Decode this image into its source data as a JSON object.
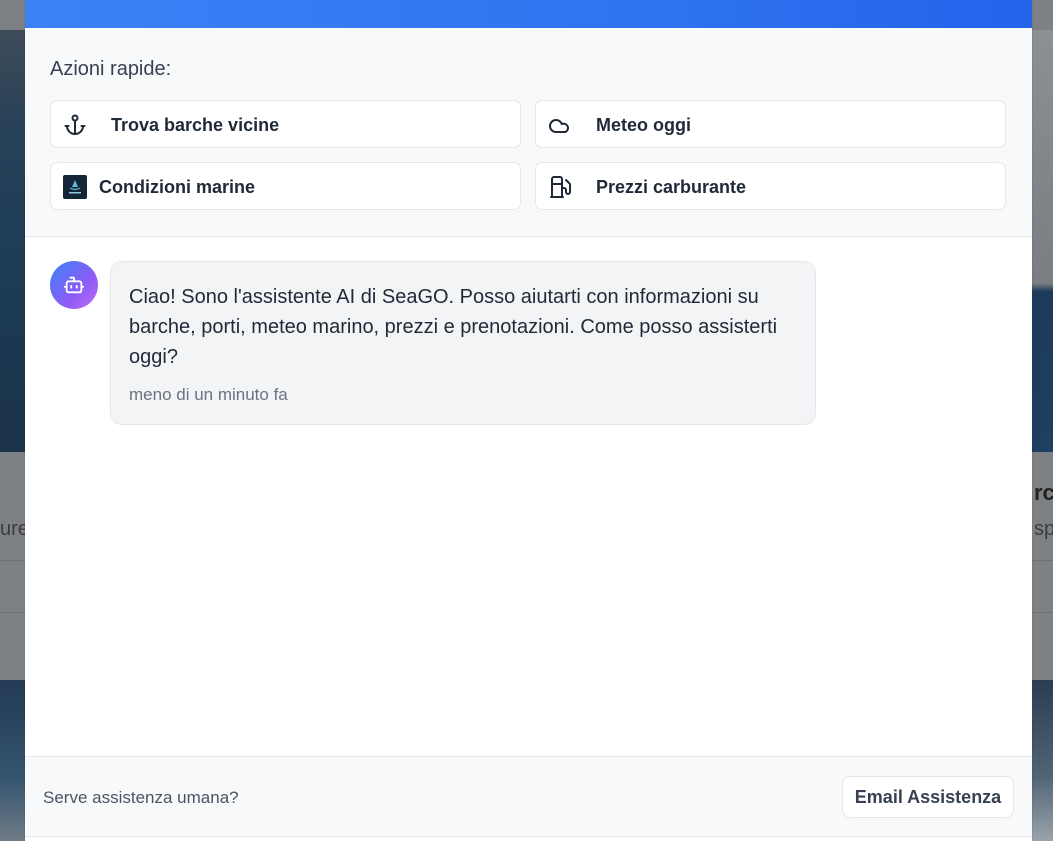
{
  "background": {
    "left_fragment": "ure",
    "right_bold_fragment": "rch",
    "right_fragment": "spe"
  },
  "quick_actions": {
    "title": "Azioni rapide:",
    "items": [
      {
        "label": "Trova barche vicine",
        "icon": "anchor-icon"
      },
      {
        "label": "Meteo oggi",
        "icon": "cloud-icon"
      },
      {
        "label": "Condizioni marine",
        "icon": "seago-logo"
      },
      {
        "label": "Prezzi carburante",
        "icon": "fuel-icon"
      }
    ]
  },
  "chat": {
    "messages": [
      {
        "sender": "assistant",
        "text": "Ciao! Sono l'assistente AI di SeaGO. Posso aiutarti con informazioni su barche, porti, meteo marino, prezzi e prenotazioni. Come posso assisterti oggi?",
        "time": "meno di un minuto fa"
      }
    ]
  },
  "footer": {
    "help_text": "Serve assistenza umana?",
    "email_button": "Email Assistenza"
  },
  "colors": {
    "header_gradient_start": "#3b82f6",
    "header_gradient_end": "#2563eb",
    "avatar_gradient_start": "#3b82f6",
    "avatar_gradient_end": "#c26bf5"
  }
}
